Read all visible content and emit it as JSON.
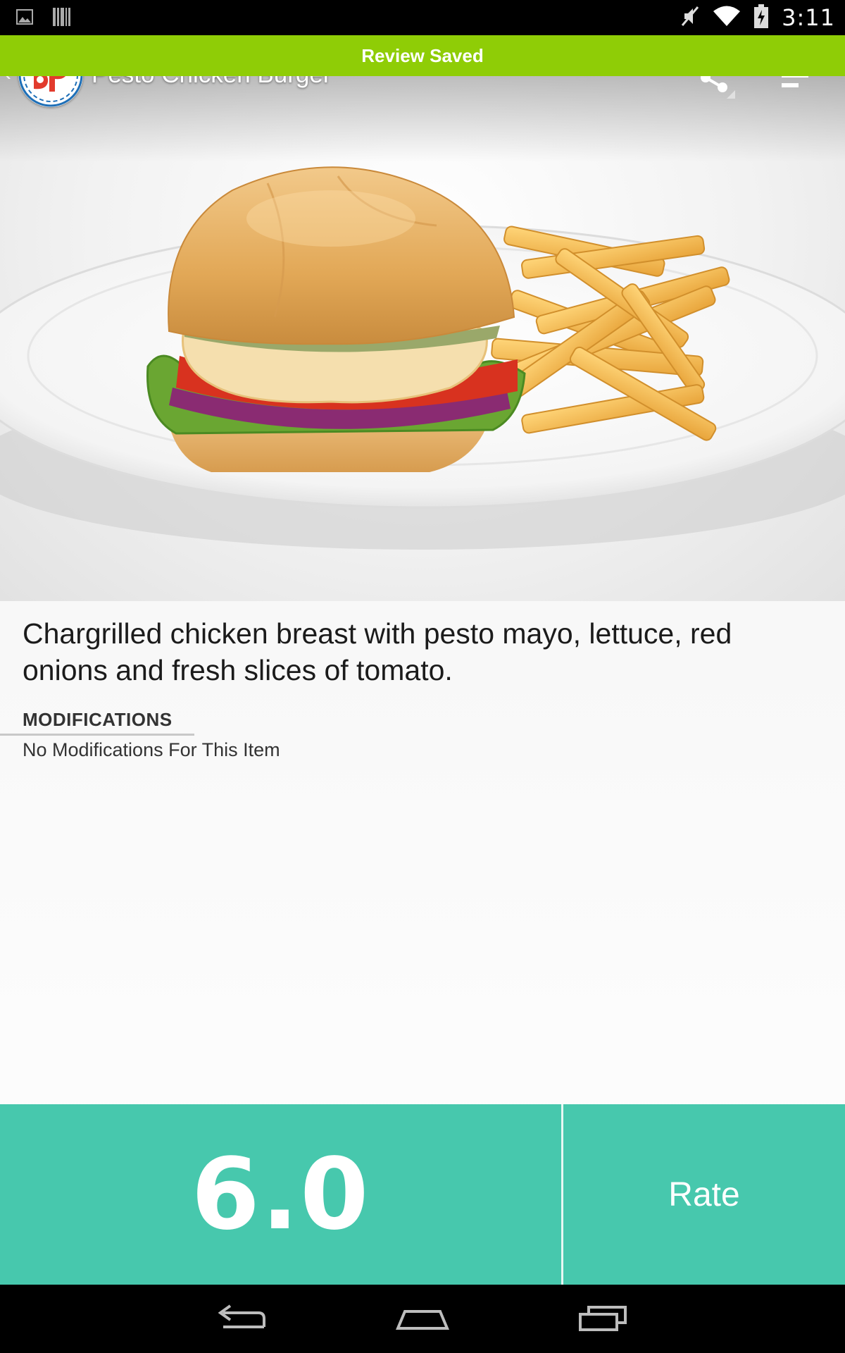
{
  "status_bar": {
    "time": "3:11",
    "left_icons": [
      "gallery-icon",
      "barcode-icon"
    ],
    "right_icons": [
      "mute-icon",
      "wifi-icon",
      "battery-charging-icon"
    ]
  },
  "toast": {
    "text": "Review Saved",
    "color": "#8fcd06"
  },
  "action_bar": {
    "title": "Pesto Chicken Burger",
    "logo_icon": "bp-logo-icon",
    "back_icon": "chevron-left-icon",
    "share_icon": "share-icon",
    "menu_icon": "filter-menu-icon"
  },
  "item": {
    "description": "Chargrilled chicken breast with pesto mayo, lettuce, red onions and fresh slices of tomato.",
    "modifications_header": "MODIFICATIONS",
    "modifications_value": "No Modifications For This Item"
  },
  "rating": {
    "score": "6.0",
    "rate_label": "Rate",
    "accent_color": "#47c8ad"
  },
  "nav_bar": {
    "icons": [
      "back-icon",
      "home-icon",
      "recent-apps-icon"
    ]
  }
}
